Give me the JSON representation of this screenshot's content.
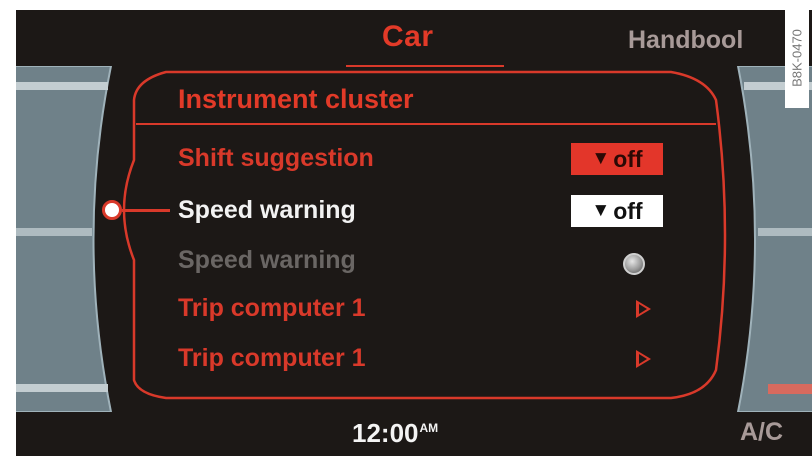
{
  "header": {
    "title": "Car",
    "right_tab": "Handbool"
  },
  "menu": {
    "heading": "Instrument cluster",
    "items": [
      {
        "label": "Shift suggestion",
        "control": "dropdown",
        "value": "off",
        "state": "highlighted"
      },
      {
        "label": "Speed warning",
        "control": "dropdown",
        "value": "off",
        "state": "selected"
      },
      {
        "label": "Speed warning",
        "control": "radio",
        "state": "disabled"
      },
      {
        "label": "Trip computer 1",
        "control": "submenu-arrow"
      },
      {
        "label": "Trip computer 1",
        "control": "submenu-arrow"
      }
    ]
  },
  "footer": {
    "time": "12:00",
    "time_suffix": "AM",
    "right_label": "A/C"
  },
  "image_code": "B8K-0470",
  "colors": {
    "accent_red": "#e23a28",
    "background": "#1c1816",
    "text_white": "#f2f2f2",
    "disabled_gray": "#6a6664",
    "tab_gray": "#a89a98"
  }
}
